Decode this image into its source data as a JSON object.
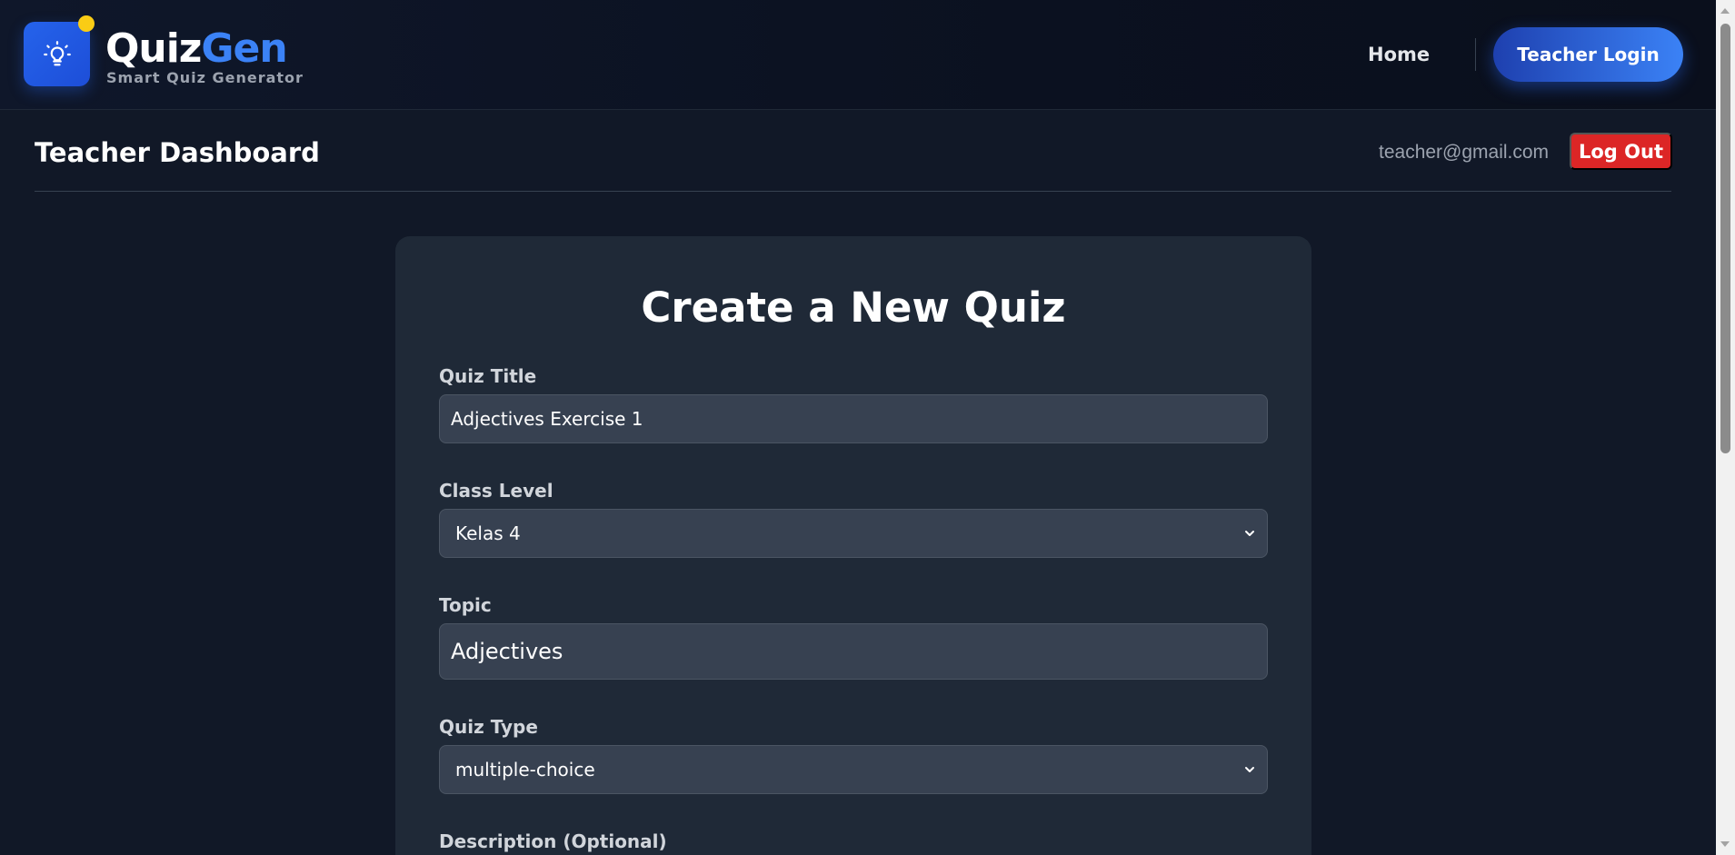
{
  "navbar": {
    "brand_quiz": "Quiz",
    "brand_gen": "Gen",
    "tagline": "Smart Quiz Generator",
    "home": "Home",
    "teacher_login": "Teacher Login"
  },
  "dashboard": {
    "title": "Teacher Dashboard",
    "email": "teacher@gmail.com",
    "logout": "Log Out"
  },
  "form": {
    "title": "Create a New Quiz",
    "quiz_title_label": "Quiz Title",
    "quiz_title_value": "Adjectives Exercise 1",
    "class_level_label": "Class Level",
    "class_level_value": "Kelas 4",
    "topic_label": "Topic",
    "topic_value": "Adjectives",
    "quiz_type_label": "Quiz Type",
    "quiz_type_value": "multiple-choice",
    "description_label": "Description (Optional)"
  },
  "colors": {
    "accent": "#3b82f6",
    "logout": "#dc2626",
    "logo_dot": "#facc15"
  },
  "icons": {
    "logo": "lightbulb-icon",
    "select": "chevron-down-icon"
  }
}
